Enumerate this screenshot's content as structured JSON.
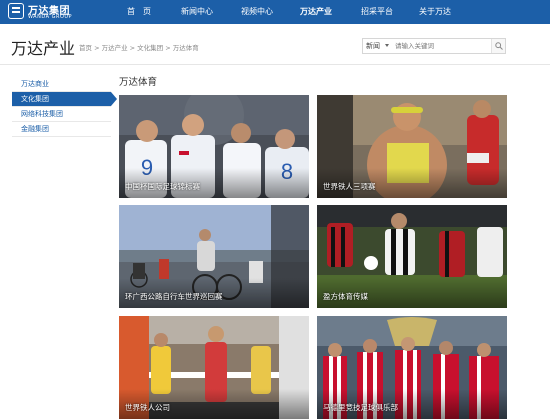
{
  "brand": {
    "name_cn": "万达集团",
    "name_en": "WANDA GROUP"
  },
  "nav": {
    "items": [
      {
        "label": "首　页"
      },
      {
        "label": "新闻中心"
      },
      {
        "label": "视频中心"
      },
      {
        "label": "万达产业"
      },
      {
        "label": "招采平台"
      },
      {
        "label": "关于万达"
      }
    ],
    "active_index": 3
  },
  "header": {
    "title": "万达产业",
    "breadcrumb": "首页 > 万达产业 > 文化集团 > 万达体育"
  },
  "search": {
    "category": "新闻",
    "placeholder": "请输入关键词"
  },
  "sidebar": {
    "items": [
      {
        "label": "万达商业"
      },
      {
        "label": "文化集团"
      },
      {
        "label": "网络科技集团"
      },
      {
        "label": "金融集团"
      }
    ],
    "active_index": 1
  },
  "main": {
    "section_title": "万达体育",
    "cards": [
      {
        "label": "中国杯国际足球锦标赛"
      },
      {
        "label": "世界铁人三项赛"
      },
      {
        "label": "环广西公路自行车世界巡回赛"
      },
      {
        "label": "盈方体育传媒"
      },
      {
        "label": "世界铁人公司"
      },
      {
        "label": "马德里竞技足球俱乐部"
      }
    ]
  },
  "colors": {
    "brand_blue": "#1c5fa8"
  }
}
